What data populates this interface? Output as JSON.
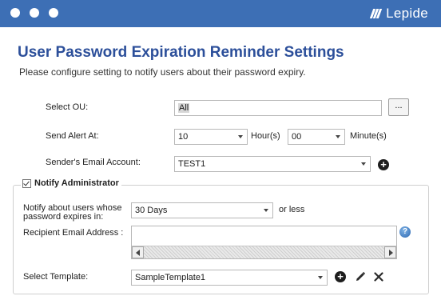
{
  "window": {
    "brand": "Lepide",
    "icons": [
      "window-dot",
      "window-dot",
      "window-dot",
      "lepide-logo-icon"
    ]
  },
  "header": {
    "title": "User Password Expiration Reminder Settings",
    "subtitle": "Please configure setting to notify users about their password expiry."
  },
  "form": {
    "select_ou": {
      "label": "Select OU:",
      "value": "All",
      "browse_label": "..."
    },
    "send_alert": {
      "label": "Send Alert At:",
      "hour_value": "10",
      "hour_unit": "Hour(s)",
      "minute_value": "00",
      "minute_unit": "Minute(s)"
    },
    "sender_email": {
      "label": "Sender's Email Account:",
      "value": "TEST1",
      "add_icon": "plus-circle-icon"
    }
  },
  "notify_admin": {
    "checkbox_label": "Notify Administrator",
    "checked": true,
    "notify_about": {
      "label_line1": "Notify about users whose",
      "label_line2": "password expires in:",
      "value": "30 Days",
      "suffix": "or less"
    },
    "recipient": {
      "label": "Recipient Email Address :",
      "value": ""
    },
    "template": {
      "label": "Select Template:",
      "value": "SampleTemplate1"
    }
  },
  "colors": {
    "titlebar": "#3d6fb5",
    "heading": "#2c4f9a"
  }
}
